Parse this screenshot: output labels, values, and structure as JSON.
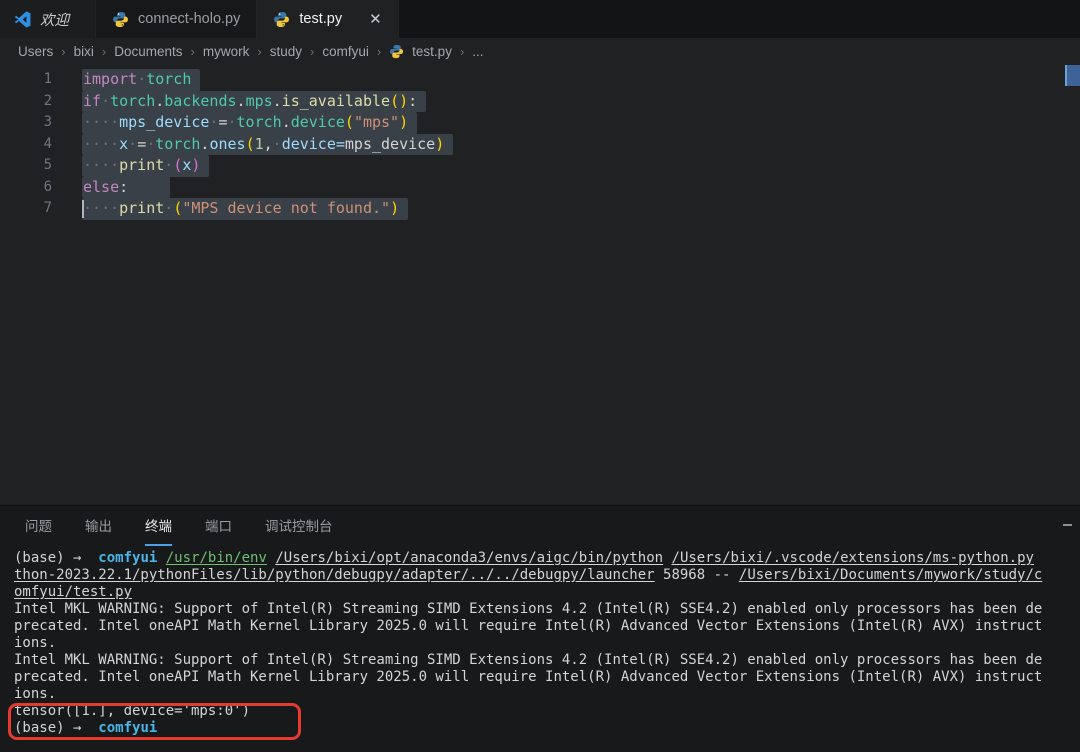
{
  "tabs": [
    {
      "label": "欢迎",
      "icon": "vscode-logo-icon",
      "active": false
    },
    {
      "label": "connect-holo.py",
      "icon": "python-icon",
      "active": false
    },
    {
      "label": "test.py",
      "icon": "python-icon",
      "active": true,
      "close_glyph": "✕"
    }
  ],
  "breadcrumb": {
    "separator": "›",
    "items": [
      "Users",
      "bixi",
      "Documents",
      "mywork",
      "study",
      "comfyui",
      "test.py",
      "..."
    ]
  },
  "editor": {
    "colors": {
      "keyword": "#c586c0",
      "namespace": "#4ec9b0",
      "punct": "#d4d4d4",
      "fn": "#dcdcaa",
      "fnTeal": "#4ec9b0",
      "fnBlue": "#9cdcfe",
      "variable": "#9cdcfe",
      "string": "#ce9178",
      "number": "#b5cea8",
      "brGold": "#ffd700",
      "brPink": "#d670d6",
      "plain": "#d4d4d4"
    },
    "lines": [
      {
        "n": "1",
        "tokens": [
          {
            "t": "import",
            "c": "keyword"
          },
          {
            "t": " ",
            "c": "sp"
          },
          {
            "t": "torch",
            "c": "namespace"
          }
        ]
      },
      {
        "n": "2",
        "tokens": [
          {
            "t": "if",
            "c": "keyword"
          },
          {
            "t": " ",
            "c": "sp"
          },
          {
            "t": "torch",
            "c": "namespace"
          },
          {
            "t": ".",
            "c": "punct"
          },
          {
            "t": "backends",
            "c": "namespace"
          },
          {
            "t": ".",
            "c": "punct"
          },
          {
            "t": "mps",
            "c": "namespace"
          },
          {
            "t": ".",
            "c": "punct"
          },
          {
            "t": "is_available",
            "c": "fn"
          },
          {
            "t": "(",
            "c": "brGold"
          },
          {
            "t": ")",
            "c": "brGold"
          },
          {
            "t": ":",
            "c": "punct"
          }
        ]
      },
      {
        "n": "3",
        "tokens": [
          {
            "t": "    ",
            "c": "sp"
          },
          {
            "t": "mps_device",
            "c": "variable"
          },
          {
            "t": " ",
            "c": "sp"
          },
          {
            "t": "=",
            "c": "punct"
          },
          {
            "t": " ",
            "c": "sp"
          },
          {
            "t": "torch",
            "c": "namespace"
          },
          {
            "t": ".",
            "c": "punct"
          },
          {
            "t": "device",
            "c": "fnTeal"
          },
          {
            "t": "(",
            "c": "brGold"
          },
          {
            "t": "\"mps\"",
            "c": "string"
          },
          {
            "t": ")",
            "c": "brGold"
          }
        ]
      },
      {
        "n": "4",
        "tokens": [
          {
            "t": "    ",
            "c": "sp"
          },
          {
            "t": "x",
            "c": "variable"
          },
          {
            "t": " ",
            "c": "sp"
          },
          {
            "t": "=",
            "c": "punct"
          },
          {
            "t": " ",
            "c": "sp"
          },
          {
            "t": "torch",
            "c": "namespace"
          },
          {
            "t": ".",
            "c": "punct"
          },
          {
            "t": "ones",
            "c": "fnBlue"
          },
          {
            "t": "(",
            "c": "brGold"
          },
          {
            "t": "1",
            "c": "number"
          },
          {
            "t": ",",
            "c": "punct"
          },
          {
            "t": " ",
            "c": "sp"
          },
          {
            "t": "device",
            "c": "variable"
          },
          {
            "t": "=",
            "c": "fnBlue"
          },
          {
            "t": "mps_device",
            "c": "plain"
          },
          {
            "t": ")",
            "c": "brGold"
          }
        ]
      },
      {
        "n": "5",
        "tokens": [
          {
            "t": "    ",
            "c": "sp"
          },
          {
            "t": "print",
            "c": "fn"
          },
          {
            "t": " ",
            "c": "sp"
          },
          {
            "t": "(",
            "c": "brPink"
          },
          {
            "t": "x",
            "c": "variable"
          },
          {
            "t": ")",
            "c": "brPink"
          }
        ]
      },
      {
        "n": "6",
        "extra": true,
        "tokens": [
          {
            "t": "else",
            "c": "keyword"
          },
          {
            "t": ":",
            "c": "punct"
          }
        ]
      },
      {
        "n": "7",
        "cursor": true,
        "tokens": [
          {
            "t": "    ",
            "c": "sp"
          },
          {
            "t": "print",
            "c": "fn"
          },
          {
            "t": " ",
            "c": "sp"
          },
          {
            "t": "(",
            "c": "brGold"
          },
          {
            "t": "\"MPS device not found.\"",
            "c": "string"
          },
          {
            "t": ")",
            "c": "brGold"
          }
        ]
      }
    ]
  },
  "panel": {
    "tabs": [
      {
        "label": "问题",
        "active": false
      },
      {
        "label": "输出",
        "active": false
      },
      {
        "label": "终端",
        "active": true
      },
      {
        "label": "端口",
        "active": false
      },
      {
        "label": "调试控制台",
        "active": false
      }
    ],
    "active_underline_color": "#4ba0e8"
  },
  "terminal": {
    "lines": [
      [
        {
          "t": "(base) → ",
          "c": "plain"
        },
        {
          "t": " ",
          "c": "plain"
        },
        {
          "t": "comfyui",
          "c": "cyanBold"
        },
        {
          "t": " ",
          "c": "plain"
        },
        {
          "t": "/usr/bin/env",
          "c": "green",
          "u": true
        },
        {
          "t": " ",
          "c": "plain"
        },
        {
          "t": "/Users/bixi/opt/anaconda3/envs/aigc/bin/python",
          "c": "plain",
          "u": true
        },
        {
          "t": " ",
          "c": "plain"
        },
        {
          "t": "/Users/bixi/.vscode/extensions/ms-python.py",
          "c": "plain",
          "u": true
        }
      ],
      [
        {
          "t": "thon-2023.22.1/pythonFiles/lib/python/debugpy/adapter/../../debugpy/launcher",
          "c": "plain",
          "u": true
        },
        {
          "t": " 58968 -- ",
          "c": "plain"
        },
        {
          "t": "/Users/bixi/Documents/mywork/study/c",
          "c": "plain",
          "u": true
        }
      ],
      [
        {
          "t": "omfyui/test.py",
          "c": "plain",
          "u": true
        }
      ],
      [
        {
          "t": "Intel MKL WARNING: Support of Intel(R) Streaming SIMD Extensions 4.2 (Intel(R) SSE4.2) enabled only processors has been de",
          "c": "plain"
        }
      ],
      [
        {
          "t": "precated. Intel oneAPI Math Kernel Library 2025.0 will require Intel(R) Advanced Vector Extensions (Intel(R) AVX) instruct",
          "c": "plain"
        }
      ],
      [
        {
          "t": "ions.",
          "c": "plain"
        }
      ],
      [
        {
          "t": "Intel MKL WARNING: Support of Intel(R) Streaming SIMD Extensions 4.2 (Intel(R) SSE4.2) enabled only processors has been de",
          "c": "plain"
        }
      ],
      [
        {
          "t": "precated. Intel oneAPI Math Kernel Library 2025.0 will require Intel(R) Advanced Vector Extensions (Intel(R) AVX) instruct",
          "c": "plain"
        }
      ],
      [
        {
          "t": "ions.",
          "c": "plain"
        }
      ],
      [
        {
          "t": "tensor([1.], device='mps:0')",
          "c": "plain"
        }
      ],
      [
        {
          "t": "(base) → ",
          "c": "plain"
        },
        {
          "t": " ",
          "c": "plain"
        },
        {
          "t": "comfyui",
          "c": "cyanBold"
        }
      ]
    ],
    "annotation": {
      "highlighted_text": "tensor([1.], device='mps:0')",
      "color": "#e63a2e"
    }
  }
}
